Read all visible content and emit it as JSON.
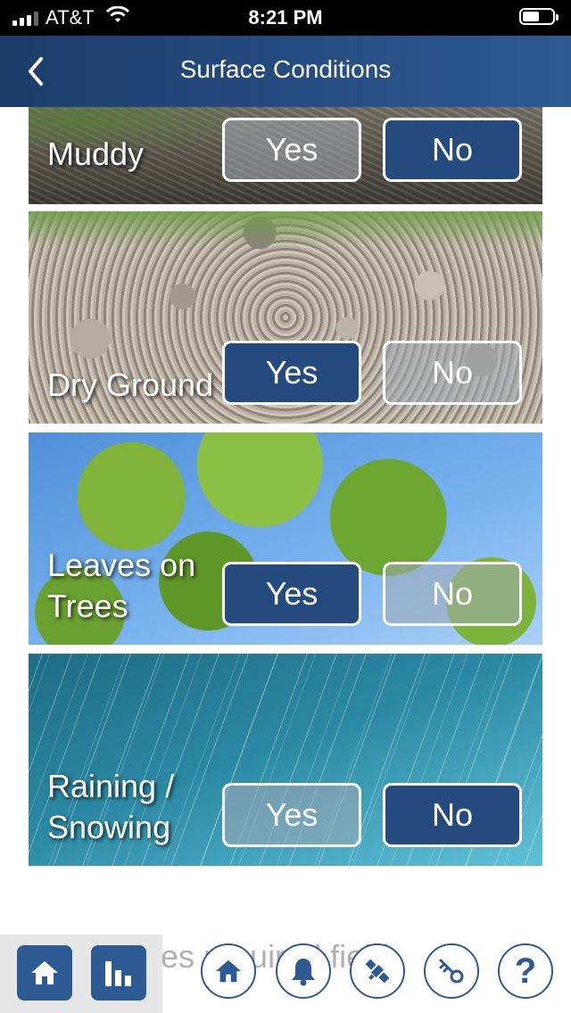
{
  "status_bar": {
    "carrier": "AT&T",
    "time": "8:21 PM",
    "battery_level": 0.5
  },
  "nav": {
    "title": "Surface Conditions",
    "back_icon": "chevron-left-icon"
  },
  "conditions": [
    {
      "label": "Muddy",
      "yes_label": "Yes",
      "no_label": "No",
      "selected": "No"
    },
    {
      "label": "Dry Ground",
      "yes_label": "Yes",
      "no_label": "No",
      "selected": "Yes"
    },
    {
      "label": "Leaves on Trees",
      "yes_label": "Yes",
      "no_label": "No",
      "selected": "Yes"
    },
    {
      "label": "Raining / Snowing",
      "yes_label": "Yes",
      "no_label": "No",
      "selected": "No"
    }
  ],
  "footer_text": "es required field",
  "toolbar": {
    "left": [
      {
        "icon": "home-icon"
      },
      {
        "icon": "bar-chart-icon"
      }
    ],
    "right": [
      {
        "icon": "home-icon"
      },
      {
        "icon": "bell-icon"
      },
      {
        "icon": "satellite-icon"
      },
      {
        "icon": "key-icon"
      },
      {
        "icon": "help-icon",
        "text": "?"
      }
    ]
  },
  "colors": {
    "nav_start": "#1c3d6b",
    "nav_end": "#2d5a93",
    "selected_button": "#244a7e",
    "icon_blue": "#2d5a93"
  }
}
